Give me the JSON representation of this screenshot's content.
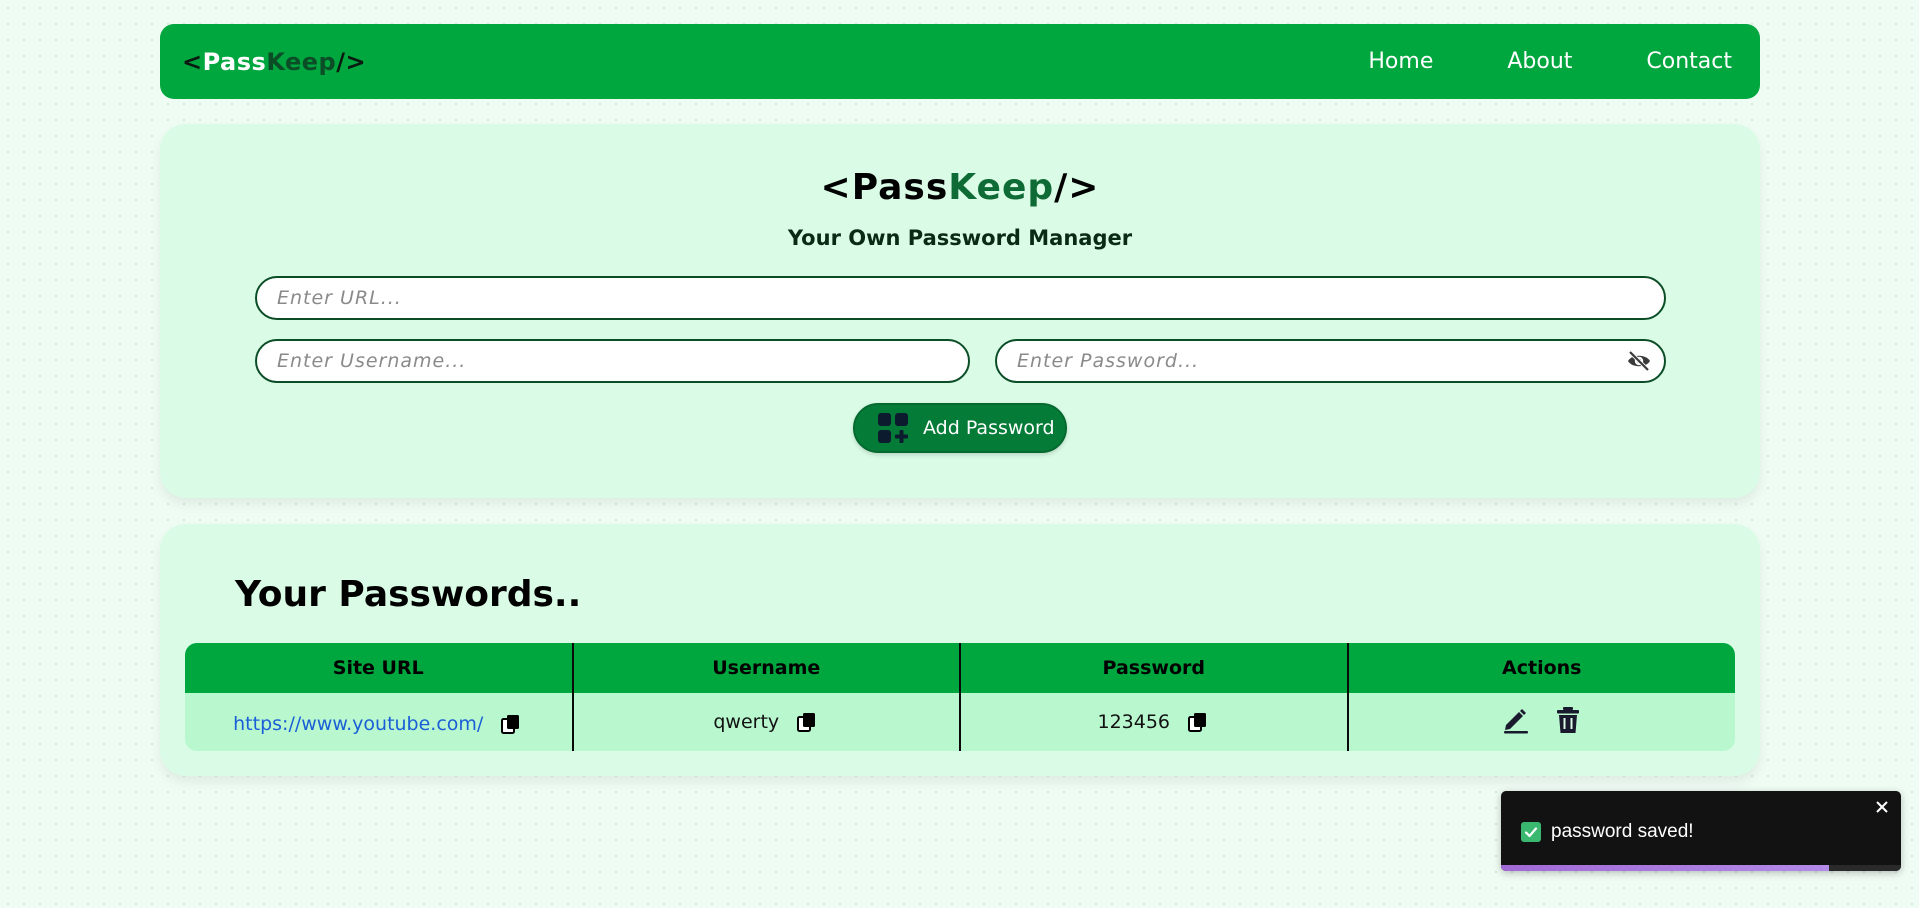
{
  "navbar": {
    "logo": {
      "open": "<",
      "pass": "Pass",
      "keep": "Keep",
      "close": "/>"
    },
    "links": [
      "Home",
      "About",
      "Contact"
    ]
  },
  "form": {
    "logo": {
      "open": "<",
      "pass": "Pass",
      "keep": "Keep",
      "close": "/>"
    },
    "subtitle": "Your Own Password Manager",
    "url_placeholder": "Enter URL...",
    "username_placeholder": "Enter Username...",
    "password_placeholder": "Enter Password...",
    "password_toggle_icon": "eye-slash-icon",
    "add_button_label": "Add Password",
    "add_button_icon": "add-grid-icon"
  },
  "passwords": {
    "heading": "Your Passwords..",
    "columns": [
      "Site URL",
      "Username",
      "Password",
      "Actions"
    ],
    "rows": [
      {
        "site": "https://www.youtube.com/",
        "username": "qwerty",
        "password": "123456"
      }
    ],
    "action_icons": [
      "edit-icon",
      "delete-icon"
    ]
  },
  "toast": {
    "message": "password saved!",
    "progress": 0.82,
    "status_color": "#3ab870",
    "progress_color": "#a16ad6"
  },
  "colors": {
    "brand_green": "#00a63e",
    "dark_green": "#0b4d26",
    "card_bg": "#dafbe6",
    "row_bg": "#b9f8cf",
    "link_blue": "#1a5fd6"
  }
}
